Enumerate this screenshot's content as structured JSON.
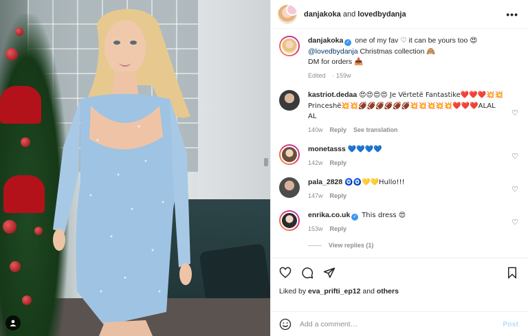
{
  "header": {
    "user1": "danjakoka",
    "and_text": " and ",
    "user2": "lovedbydanja",
    "more": "•••"
  },
  "caption": {
    "username": "danjakoka",
    "line1": "one of my fav ♡ it can be yours too 😍",
    "mention": "@lovedbydanja",
    "line2": "Christmas collection 🙈",
    "line3": "DM for orders 📥",
    "edited": "Edited",
    "time": "159w"
  },
  "comments": [
    {
      "username": "kastriot.dedaa",
      "text": "😍😍😍😍 Je Vërtetë Fantastike❤️❤️❤️💥💥Princeshë💥💥🏈🏈🏈🏈🏈🏈💥💥💥💥💥❤️❤️❤️ALAL AL",
      "time": "140w",
      "reply": "Reply",
      "extra": "See translation",
      "verified": false
    },
    {
      "username": "monetasss",
      "text": "💙💙💙💙",
      "time": "142w",
      "reply": "Reply",
      "extra": "",
      "verified": false
    },
    {
      "username": "pala_2828",
      "text": "🧿🧿💛💛Hullo!!!",
      "time": "147w",
      "reply": "Reply",
      "extra": "",
      "verified": false
    },
    {
      "username": "enrika.co.uk",
      "text": "This dress 😍",
      "time": "153w",
      "reply": "Reply",
      "extra": "",
      "verified": true
    }
  ],
  "view_replies": "View replies (1)",
  "likes": {
    "prefix": "Liked by ",
    "user": "eva_prifti_ep12",
    "mid": " and ",
    "others": "others"
  },
  "add_comment": {
    "placeholder": "Add a comment…",
    "post_label": "Post"
  },
  "colors": {
    "link": "#00376b",
    "verified": "#3897f0",
    "post_disabled": "#b2dffc",
    "meta": "#8e8e8e"
  }
}
